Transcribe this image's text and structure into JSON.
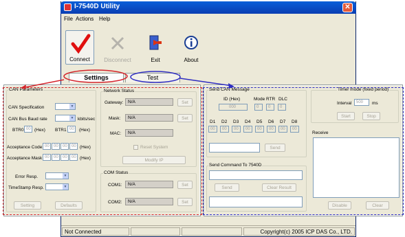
{
  "window": {
    "title": "I-7540D Utility",
    "close_glyph": "✕"
  },
  "menu": {
    "file": "File",
    "actions": "Actions",
    "help": "Help"
  },
  "toolbar": {
    "connect": "Connect",
    "disconnect": "Disconnect",
    "exit": "Exit",
    "about": "About"
  },
  "tabs": {
    "settings": "Settings",
    "test": "Test"
  },
  "can_params": {
    "group": "CAN Parameters",
    "spec": "CAN Specification",
    "baud": "CAN Bus Baud rate",
    "baud_unit": "kbits/sec",
    "btr0": "BTR0",
    "btr1": "BTR1",
    "hex": "(Hex)",
    "btr_val": "00",
    "acc_code": "Acceptance Code",
    "acc_mask": "Acceptance Mask",
    "acc_val": "00",
    "err_resp": "Error Resp.",
    "ts_resp": "TimeStamp Resp.",
    "setting_btn": "Setting",
    "defaults_btn": "Defaults"
  },
  "network": {
    "group": "Network Status",
    "gateway": "Gateway:",
    "mask": "Mask:",
    "mac": "MAC:",
    "na": "N/A",
    "set": "Set",
    "reset": "Reset System",
    "modify": "Modify IP"
  },
  "com": {
    "group": "COM Status",
    "com1": "COM1:",
    "com2": "COM2:",
    "na": "N/A",
    "set": "Set"
  },
  "send_can": {
    "group": "Send CAN Message",
    "id": "ID (Hex)",
    "mode": "Mode",
    "rtr": "RTR",
    "dlc": "DLC",
    "id_val": "000",
    "mode_val": "0",
    "rtr_val": "0",
    "dlc_val": "0",
    "d_labels": [
      "D1",
      "D2",
      "D3",
      "D4",
      "D5",
      "D6",
      "D7",
      "D8"
    ],
    "d_val": "00",
    "send": "Send"
  },
  "send_cmd": {
    "group": "Send Command To 7540D",
    "send": "Send",
    "clear": "Clear Result"
  },
  "timer": {
    "group": "Timer mode (fixed period)",
    "interval": "Interval",
    "interval_val": "500",
    "unit": "ms",
    "start": "Start",
    "stop": "Stop"
  },
  "receive": {
    "label": "Receive",
    "disable": "Disable",
    "clear": "Clear"
  },
  "status": {
    "conn": "Not Connected",
    "copyright": "Copyright(c) 2005 ICP DAS Co., LTD."
  },
  "colors": {
    "annot_red": "#d4242b",
    "annot_blue": "#2f2dc2",
    "title_blue": "#0a3db3"
  }
}
